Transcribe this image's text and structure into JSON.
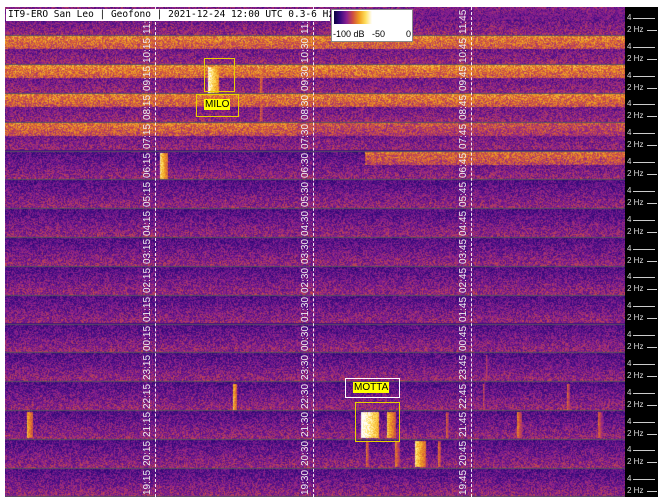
{
  "chart_data": {
    "type": "heatmap",
    "title": "IT9-ERO San Leo | Geofono | 2021-12-24 12:00 UTC 0.3-6 Hz",
    "colorbar": {
      "ticks": [
        "-100 dB",
        "-50",
        "0"
      ],
      "range_db": [
        -100,
        0
      ],
      "colormap": [
        "#0a0040",
        "#8a2090",
        "#f0a020",
        "#ffe060",
        "#ffffff"
      ]
    },
    "rows": [
      {
        "hour": "11",
        "labels": [
          "11:15",
          "11:30",
          "11:45"
        ]
      },
      {
        "hour": "10",
        "labels": [
          "10:15",
          "10:30",
          "10:45"
        ]
      },
      {
        "hour": "09",
        "labels": [
          "09:15",
          "09:30",
          "09:45"
        ]
      },
      {
        "hour": "08",
        "labels": [
          "08:15",
          "08:30",
          "08:45"
        ]
      },
      {
        "hour": "07",
        "labels": [
          "07:15",
          "07:30",
          "07:45"
        ]
      },
      {
        "hour": "06",
        "labels": [
          "06:15",
          "06:30",
          "06:45"
        ]
      },
      {
        "hour": "05",
        "labels": [
          "05:15",
          "05:30",
          "05:45"
        ]
      },
      {
        "hour": "04",
        "labels": [
          "04:15",
          "04:30",
          "04:45"
        ]
      },
      {
        "hour": "03",
        "labels": [
          "03:15",
          "03:30",
          "03:45"
        ]
      },
      {
        "hour": "02",
        "labels": [
          "02:15",
          "02:30",
          "02:45"
        ]
      },
      {
        "hour": "01",
        "labels": [
          "01:15",
          "01:30",
          "01:45"
        ]
      },
      {
        "hour": "00",
        "labels": [
          "00:15",
          "00:30",
          "00:45"
        ]
      },
      {
        "hour": "23",
        "labels": [
          "23:15",
          "23:30",
          "23:45"
        ]
      },
      {
        "hour": "22",
        "labels": [
          "22:15",
          "22:30",
          "22:45"
        ]
      },
      {
        "hour": "21",
        "labels": [
          "21:15",
          "21:30",
          "21:45"
        ]
      },
      {
        "hour": "20",
        "labels": [
          "20:15",
          "20:30",
          "20:45"
        ]
      },
      {
        "hour": "19",
        "labels": [
          "19:15",
          "19:30",
          "19:45"
        ]
      }
    ],
    "frequency_ticks": [
      "4",
      "2 Hz"
    ],
    "annotations": [
      {
        "label": "MILO",
        "time": "09:20"
      },
      {
        "label": "MOTTA",
        "time": "21:24"
      }
    ]
  }
}
